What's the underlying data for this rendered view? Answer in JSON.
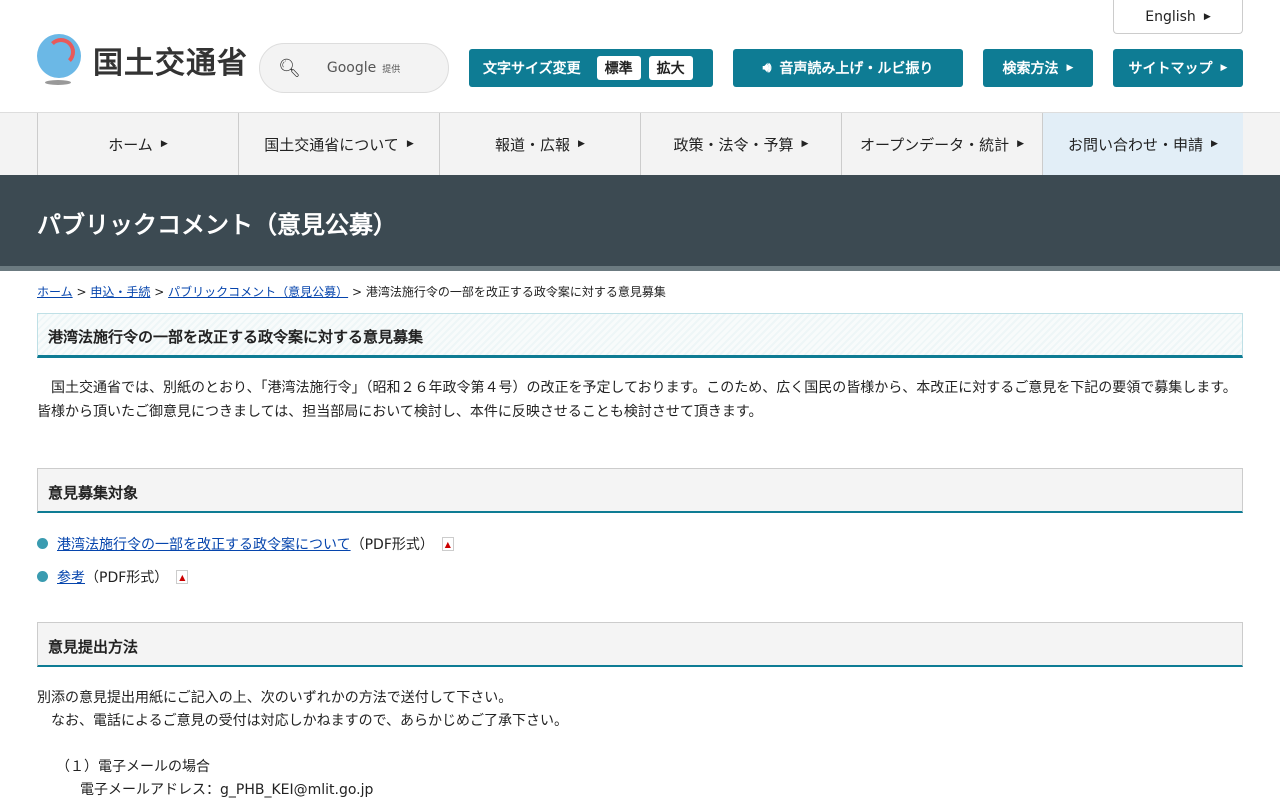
{
  "header": {
    "logo_text": "国土交通省",
    "english": "English",
    "search_provider": "Google",
    "search_suffix": "提供",
    "font_size_label": "文字サイズ変更",
    "font_standard": "標準",
    "font_large": "拡大",
    "speech": "音声読み上げ・ルビ振り",
    "search_method": "検索方法",
    "sitemap": "サイトマップ"
  },
  "nav": [
    "ホーム",
    "国土交通省について",
    "報道・広報",
    "政策・法令・予算",
    "オープンデータ・統計",
    "お問い合わせ・申請"
  ],
  "banner": "パブリックコメント（意見公募）",
  "breadcrumb": {
    "home": "ホーム",
    "apply": "申込・手続",
    "pubcom": "パブリックコメント（意見公募）",
    "current": "港湾法施行令の一部を改正する政令案に対する意見募集",
    "sep": ">"
  },
  "title": "港湾法施行令の一部を改正する政令案に対する意見募集",
  "intro": "　国土交通省では、別紙のとおり、「港湾法施行令」（昭和２６年政令第４号）の改正を予定しております。このため、広く国民の皆様から、本改正に対するご意見を下記の要領で募集します。　 皆様から頂いたご御意見につきましては、担当部局において検討し、本件に反映させることも検討させて頂きます。",
  "sections": {
    "target": {
      "heading": "意見募集対象",
      "items": [
        {
          "link": "港湾法施行令の一部を改正する政令案について",
          "suffix": "（PDF形式）"
        },
        {
          "link": "参考",
          "suffix": "（PDF形式）"
        }
      ]
    },
    "method": {
      "heading": "意見提出方法",
      "line1": "別添の意見提出用紙にご記入の上、次のいずれかの方法で送付して下さい。",
      "line2": "　なお、電話によるご意見の受付は対応しかねますので、あらかじめご了承下さい。",
      "email_h": "（１）電子メールの場合",
      "email": "電子メールアドレス：g_PHB_KEI@mlit.go.jp"
    }
  }
}
